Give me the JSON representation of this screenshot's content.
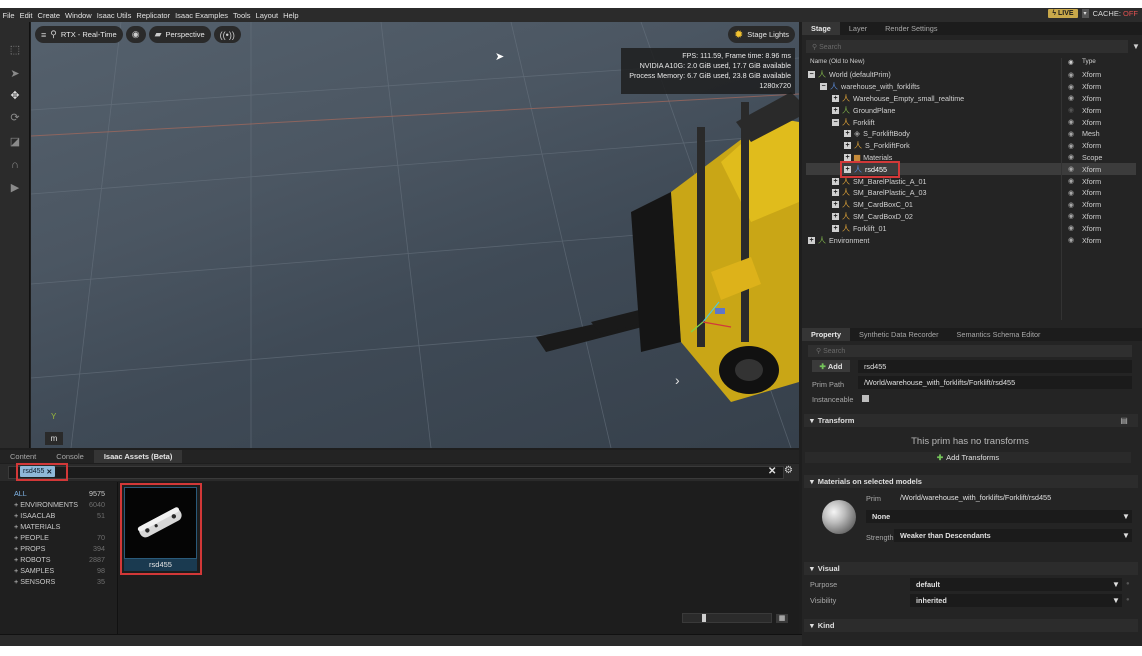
{
  "menubar": {
    "items": [
      "File",
      "Edit",
      "Create",
      "Window",
      "Isaac Utils",
      "Replicator",
      "Isaac Examples",
      "Tools",
      "Layout",
      "Help"
    ],
    "live_label": "LIVE",
    "live_caret": "▾",
    "cache_label": "CACHE:",
    "cache_state": "OFF"
  },
  "viewport": {
    "render_mode": "RTX - Real-Time",
    "camera": "Perspective",
    "stage_lights": "Stage Lights",
    "stats": [
      "FPS: 111.59, Frame time: 8.96 ms",
      "NVIDIA A10G: 2.0 GiB used, 17.7 GiB available",
      "Process Memory: 6.7 GiB used, 23.8 GiB available",
      "1280x720"
    ],
    "axis_label": "Y",
    "unit_label": "m"
  },
  "bottom": {
    "tabs": [
      "Content",
      "Console",
      "Isaac Assets (Beta)"
    ],
    "active_tab": 2,
    "search_chip": "rsd455",
    "categories": [
      {
        "label": "ALL",
        "count": "9575",
        "selected": true
      },
      {
        "label": "+ ENVIRONMENTS",
        "count": "6040"
      },
      {
        "label": "+ ISAACLAB",
        "count": "51"
      },
      {
        "label": "+ MATERIALS",
        "count": ""
      },
      {
        "label": "+ PEOPLE",
        "count": "70"
      },
      {
        "label": "+ PROPS",
        "count": "394"
      },
      {
        "label": "+ ROBOTS",
        "count": "2887"
      },
      {
        "label": "+ SAMPLES",
        "count": "98"
      },
      {
        "label": "+ SENSORS",
        "count": "35"
      }
    ],
    "asset_name": "rsd455"
  },
  "stage": {
    "tabs": [
      "Stage",
      "Layer",
      "Render Settings"
    ],
    "search_placeholder": "Search",
    "col_name": "Name (Old to New)",
    "col_type": "Type",
    "rows": [
      {
        "name": "World (defaultPrim)",
        "depth": 0,
        "type": "Xform",
        "icon": "xform-green",
        "expand": "−"
      },
      {
        "name": "warehouse_with_forklifts",
        "depth": 1,
        "type": "Xform",
        "icon": "xform-blue",
        "expand": "−"
      },
      {
        "name": "Warehouse_Empty_small_realtime",
        "depth": 2,
        "type": "Xform",
        "icon": "xform",
        "expand": "+"
      },
      {
        "name": "GroundPlane",
        "depth": 2,
        "type": "Xform",
        "icon": "xform-green",
        "expand": "+",
        "eye_dim": true
      },
      {
        "name": "Forklift",
        "depth": 2,
        "type": "Xform",
        "icon": "xform",
        "expand": "−"
      },
      {
        "name": "S_ForkliftBody",
        "depth": 3,
        "type": "Mesh",
        "icon": "mesh",
        "expand": "+"
      },
      {
        "name": "S_ForkliftFork",
        "depth": 3,
        "type": "Xform",
        "icon": "xform",
        "expand": "+"
      },
      {
        "name": "Materials",
        "depth": 3,
        "type": "Scope",
        "icon": "scope",
        "expand": "+"
      },
      {
        "name": "rsd455",
        "depth": 3,
        "type": "Xform",
        "icon": "xform-blue",
        "expand": "+",
        "selected": true
      },
      {
        "name": "SM_BarelPlastic_A_01",
        "depth": 2,
        "type": "Xform",
        "icon": "xform",
        "expand": "+"
      },
      {
        "name": "SM_BarelPlastic_A_03",
        "depth": 2,
        "type": "Xform",
        "icon": "xform",
        "expand": "+"
      },
      {
        "name": "SM_CardBoxC_01",
        "depth": 2,
        "type": "Xform",
        "icon": "xform",
        "expand": "+"
      },
      {
        "name": "SM_CardBoxD_02",
        "depth": 2,
        "type": "Xform",
        "icon": "xform",
        "expand": "+"
      },
      {
        "name": "Forklift_01",
        "depth": 2,
        "type": "Xform",
        "icon": "xform",
        "expand": "+"
      },
      {
        "name": "Environment",
        "depth": 0,
        "type": "Xform",
        "icon": "xform-green",
        "expand": "+"
      }
    ]
  },
  "property": {
    "tabs": [
      "Property",
      "Synthetic Data Recorder",
      "Semantics Schema Editor"
    ],
    "search_placeholder": "Search",
    "add_label": "Add",
    "name_value": "rsd455",
    "prim_path_label": "Prim Path",
    "prim_path_value": "/World/warehouse_with_forklifts/Forklift/rsd455",
    "instanceable_label": "Instanceable",
    "transform_header": "Transform",
    "no_transforms": "This prim has no transforms",
    "add_transforms": "Add Transforms",
    "materials_header": "Materials on selected models",
    "prim_label": "Prim",
    "material_prim_path": "/World/warehouse_with_forklifts/Forklift/rsd455",
    "material_value": "None",
    "strength_label": "Strength",
    "strength_value": "Weaker than Descendants",
    "visual_header": "Visual",
    "purpose_label": "Purpose",
    "purpose_value": "default",
    "visibility_label": "Visibility",
    "visibility_value": "inherited",
    "kind_header": "Kind"
  },
  "colors": {
    "accent_blue": "#7fb4e6",
    "highlight_red": "#d23838",
    "xform_orange": "#e0a438",
    "live_yellow": "#c8a84a"
  }
}
